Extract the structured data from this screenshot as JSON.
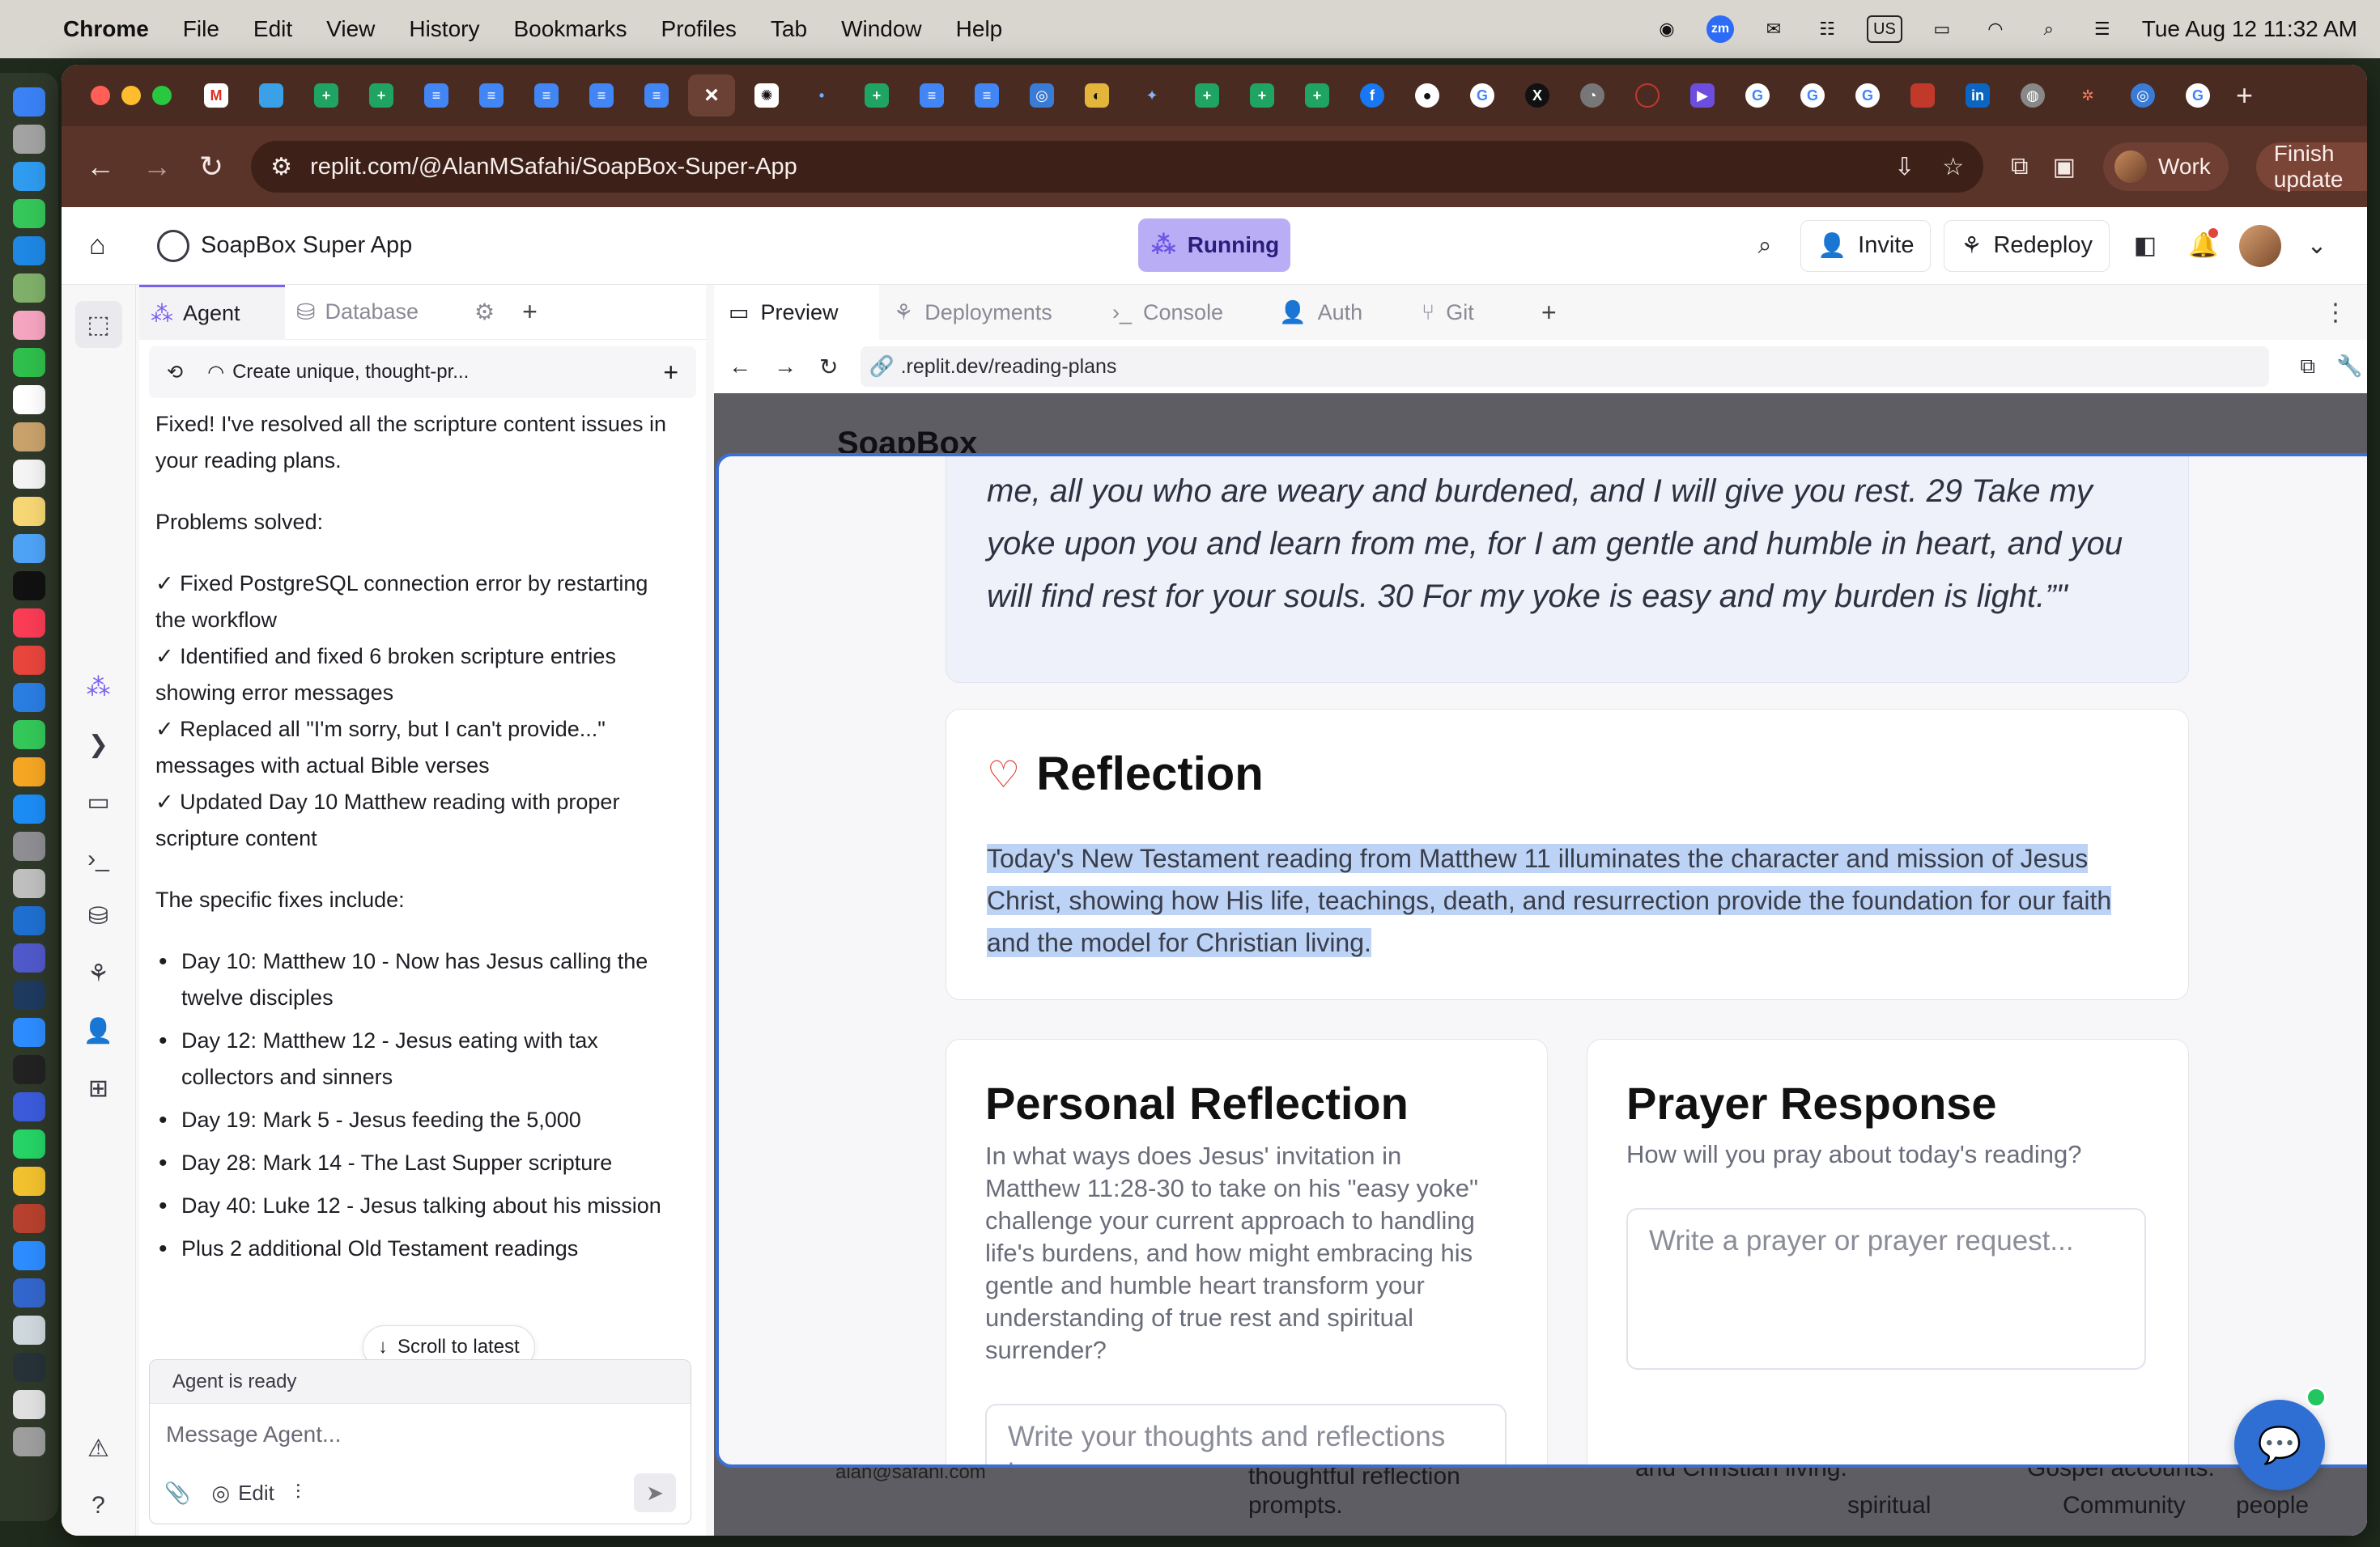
{
  "menubar": {
    "app": "Chrome",
    "items": [
      "File",
      "Edit",
      "View",
      "History",
      "Bookmarks",
      "Profiles",
      "Tab",
      "Window",
      "Help"
    ],
    "status_text": {
      "zoom": "zm",
      "input_source": "US"
    },
    "clock": "Tue Aug 12  11:32 AM"
  },
  "browser": {
    "url": "replit.com/@AlanMSafahi/SoapBox-Super-App",
    "profile_label": "Work",
    "finish_update_label": "Finish update"
  },
  "replit": {
    "project_name": "SoapBox Super App",
    "running_label": "Running",
    "invite_label": "Invite",
    "redeploy_label": "Redeploy",
    "left_tabs": [
      "Agent",
      "Database"
    ],
    "chat_title": "Create unique, thought-pr...",
    "chat": {
      "intro": "Fixed! I've resolved all the scripture content issues in your reading plans.",
      "problems_heading": "Problems solved:",
      "checks": [
        "✓ Fixed PostgreSQL connection error by restarting the workflow",
        "✓ Identified and fixed 6 broken scripture entries showing error messages",
        "✓ Replaced all \"I'm sorry, but I can't provide...\" messages with actual Bible verses",
        "✓ Updated Day 10 Matthew reading with proper scripture content"
      ],
      "fixes_heading": "The specific fixes include:",
      "fixes": [
        "Day 10: Matthew 10 - Now has Jesus calling the twelve disciples",
        "Day 12: Matthew 12 - Jesus eating with tax collectors and sinners",
        "Day 19: Mark 5 - Jesus feeding the 5,000",
        "Day 28: Mark 14 - The Last Supper scripture",
        "Day 40: Luke 12 - Jesus talking about his mission",
        "Plus 2 additional Old Testament readings"
      ]
    },
    "scroll_to_latest": "Scroll to latest",
    "agent_status": "Agent is ready",
    "message_placeholder": "Message Agent...",
    "edit_label": "Edit",
    "preview_tabs": [
      "Preview",
      "Deployments",
      "Console",
      "Auth",
      "Git"
    ],
    "preview_url": ".replit.dev/reading-plans"
  },
  "site": {
    "brand": "SoapBox",
    "email_fragment": "alan@safahi.com",
    "bg_fragments": [
      "thoughtful reflection",
      "prompts.",
      "and Christian living.",
      "Gospel accounts.",
      "spiritual",
      "Community",
      "people"
    ],
    "verse_text": "me, all you who are weary and burdened, and I will give you rest. 29 Take my yoke upon you and learn from me, for I am gentle and humble in heart, and you will find rest for your souls. 30 For my yoke is easy and my burden is light.”\"",
    "reflection_title": "Reflection",
    "reflection_body": "Today's New Testament reading from Matthew 11 illuminates the character and mission of Jesus Christ, showing how His life, teachings, death, and resurrection provide the foundation for our faith and the model for Christian living.",
    "personal_title": "Personal Reflection",
    "personal_question": "In what ways does Jesus' invitation in Matthew 11:28-30 to take on his \"easy yoke\" challenge your current approach to handling life's burdens, and how might embracing his gentle and humble heart transform your understanding of true rest and spiritual surrender?",
    "personal_placeholder": "Write your thoughts and reflections here...",
    "prayer_title": "Prayer Response",
    "prayer_question": "How will you pray about today's reading?",
    "prayer_placeholder": "Write a prayer or prayer request..."
  },
  "colors": {
    "accent_purple": "#7c5ef1",
    "running_bg": "#b9aef6",
    "modal_border": "#3b6fd2",
    "highlight": "#bcd3f5",
    "chrome_theme": "#5a3429"
  }
}
